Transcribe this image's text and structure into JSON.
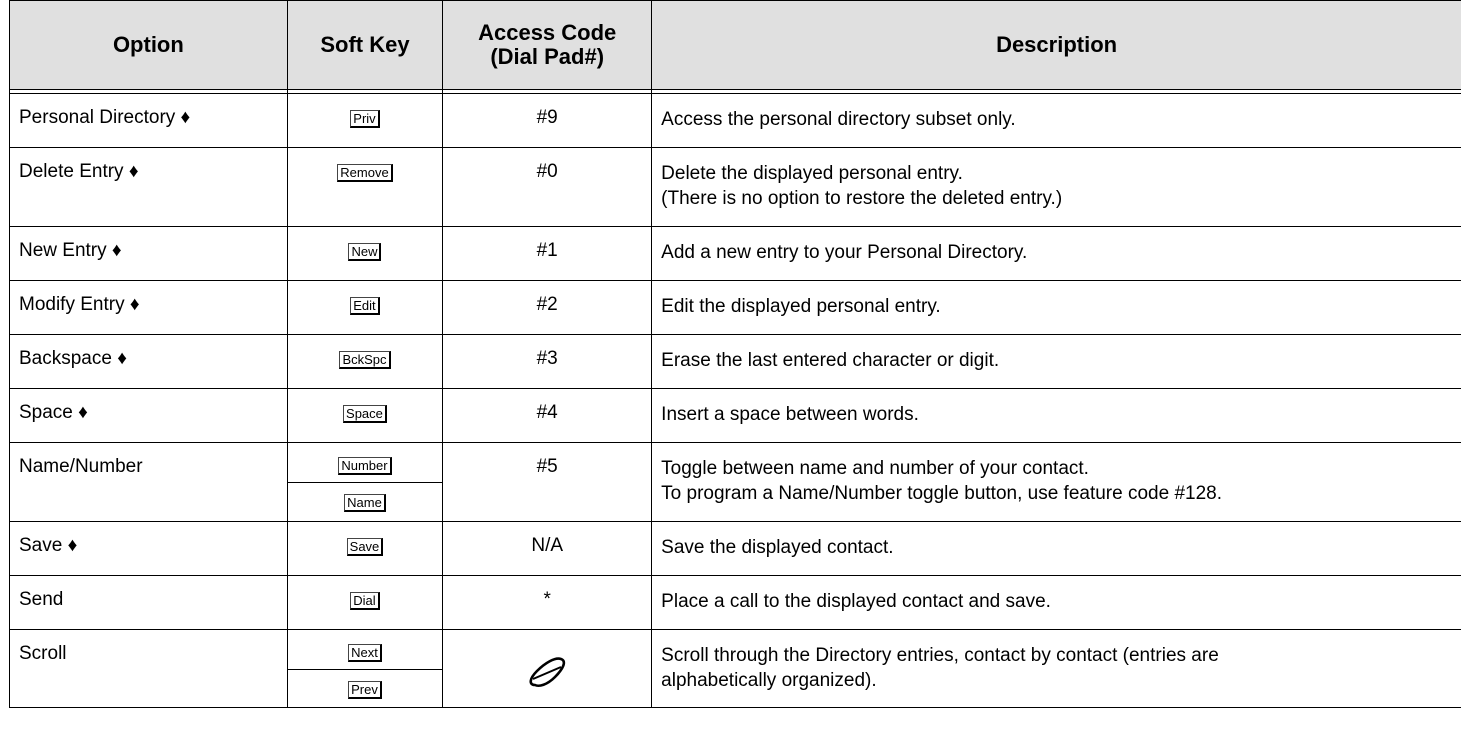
{
  "headers": {
    "option": "Option",
    "soft_key": "Soft Key",
    "access_code": "Access Code (Dial Pad#)",
    "access_code_line1": "Access Code",
    "access_code_line2": "(Dial Pad#)",
    "description": "Description"
  },
  "rows": [
    {
      "option": "Personal Directory ♦",
      "soft_key": "Priv",
      "code": "#9",
      "description": "Access the personal directory subset only."
    },
    {
      "option": "Delete Entry ♦",
      "soft_key": "Remove",
      "code": "#0",
      "description_line1": "Delete the displayed personal entry.",
      "description_line2": "(There is no option to restore the deleted entry.)"
    },
    {
      "option": "New Entry ♦",
      "soft_key": "New",
      "code": "#1",
      "description": "Add a new entry to your Personal Directory."
    },
    {
      "option": "Modify Entry ♦",
      "soft_key": "Edit",
      "code": "#2",
      "description": "Edit the displayed personal entry."
    },
    {
      "option": "Backspace ♦",
      "soft_key": "BckSpc",
      "code": "#3",
      "description": "Erase the last entered character or digit."
    },
    {
      "option": "Space ♦",
      "soft_key": "Space",
      "code": "#4",
      "description": "Insert a space between words."
    },
    {
      "option": "Name/Number",
      "soft_key": "Number",
      "soft_key_2": "Name",
      "code": "#5",
      "description_line1": "Toggle between name and number of your contact.",
      "description_line2": "To program a Name/Number toggle button, use feature code #128."
    },
    {
      "option": "Save ♦",
      "soft_key": "Save",
      "code": "N/A",
      "description": "Save the displayed contact."
    },
    {
      "option": "Send",
      "soft_key": "Dial",
      "code": "*",
      "description": "Place a call to the displayed contact and save."
    },
    {
      "option": "Scroll",
      "soft_key": "Next",
      "soft_key_2": "Prev",
      "code_icon": "scroll-pad-icon",
      "description_line1": "Scroll through the Directory entries, contact by contact (entries are",
      "description_line2": "alphabetically organized)."
    }
  ]
}
